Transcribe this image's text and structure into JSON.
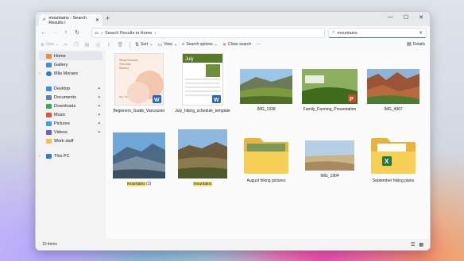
{
  "window": {
    "tab_title": "mountains - Search Results i",
    "new_tab": "+",
    "close_tab": "✕"
  },
  "nav": {
    "breadcrumb": "Search Results in Home",
    "search_value": "mountains"
  },
  "toolbar": {
    "new": "New",
    "sort": "Sort",
    "view": "View",
    "search_options": "Search options",
    "close_search": "Close search",
    "details": "Details"
  },
  "sidebar": {
    "top": [
      {
        "label": "Home",
        "icon": "home-icon",
        "color": "#e88f3c",
        "selected": true
      },
      {
        "label": "Gallery",
        "icon": "gallery-icon",
        "color": "#3b8fdc"
      },
      {
        "label": "Mila Moraes",
        "icon": "cloud-icon",
        "color": "#2c7ed6"
      }
    ],
    "quick": [
      {
        "label": "Desktop",
        "color": "#3c8de0"
      },
      {
        "label": "Documents",
        "color": "#6a7ea8"
      },
      {
        "label": "Downloads",
        "color": "#2eac5a"
      },
      {
        "label": "Music",
        "color": "#e2513f"
      },
      {
        "label": "Pictures",
        "color": "#3fa0e3"
      },
      {
        "label": "Videos",
        "color": "#7e56c8"
      },
      {
        "label": "Work stuff",
        "color": "#f2c04b"
      }
    ],
    "bottom": [
      {
        "label": "This PC",
        "color": "#2f7bd6"
      }
    ]
  },
  "files": [
    {
      "name": "Beginners_Guide_Vancouver",
      "kind": "doc"
    },
    {
      "name": "July_hiking_schedule_template",
      "kind": "calendar"
    },
    {
      "name": "IMG_1938",
      "kind": "photo-valley"
    },
    {
      "name": "Family_Farming_Presentation",
      "kind": "presentation"
    },
    {
      "name": "IMG_4967",
      "kind": "photo-canyon"
    },
    {
      "name_prefix": "",
      "name_hl": "mountains",
      "name_suffix": " (2)",
      "kind": "photo-cliff"
    },
    {
      "name_prefix": "",
      "name_hl": "mountains",
      "name_suffix": "",
      "kind": "photo-mesa"
    },
    {
      "name": "August hiking pictures",
      "kind": "folder-photo"
    },
    {
      "name": "IMG_1904",
      "kind": "photo-desert"
    },
    {
      "name": "September hiking plans",
      "kind": "folder-excel"
    }
  ],
  "doc_preview": {
    "lines": [
      "Mount Seymour",
      "Adventure",
      "Itinerary"
    ],
    "footer": "Day Trip"
  },
  "calendar_preview": {
    "month": "July"
  },
  "status": {
    "count": "10 items"
  }
}
